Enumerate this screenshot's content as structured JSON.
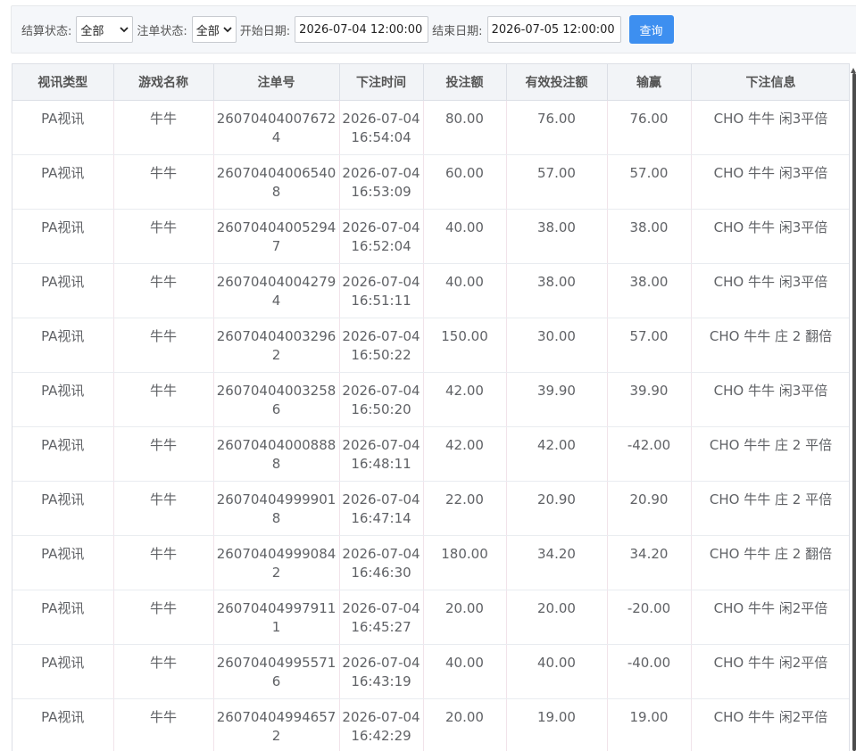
{
  "filters": {
    "settle_label": "结算状态:",
    "settle_value": "全部",
    "order_label": "注单状态:",
    "order_value": "全部",
    "start_label": "开始日期:",
    "start_value": "2026-07-04 12:00:00",
    "end_label": "结束日期:",
    "end_value": "2026-07-05 12:00:00",
    "query_label": "查询"
  },
  "table": {
    "headers": [
      "视讯类型",
      "游戏名称",
      "注单号",
      "下注时间",
      "投注额",
      "有效投注额",
      "输赢",
      "下注信息"
    ],
    "rows": [
      [
        "PA视讯",
        "牛牛",
        "260704040076724",
        "2026-07-04 16:54:04",
        "80.00",
        "76.00",
        "76.00",
        "CHO 牛牛 闲3平倍"
      ],
      [
        "PA视讯",
        "牛牛",
        "260704040065408",
        "2026-07-04 16:53:09",
        "60.00",
        "57.00",
        "57.00",
        "CHO 牛牛 闲3平倍"
      ],
      [
        "PA视讯",
        "牛牛",
        "260704040052947",
        "2026-07-04 16:52:04",
        "40.00",
        "38.00",
        "38.00",
        "CHO 牛牛 闲3平倍"
      ],
      [
        "PA视讯",
        "牛牛",
        "260704040042794",
        "2026-07-04 16:51:11",
        "40.00",
        "38.00",
        "38.00",
        "CHO 牛牛 闲3平倍"
      ],
      [
        "PA视讯",
        "牛牛",
        "260704040032962",
        "2026-07-04 16:50:22",
        "150.00",
        "30.00",
        "57.00",
        "CHO 牛牛 庄 2 翻倍"
      ],
      [
        "PA视讯",
        "牛牛",
        "260704040032586",
        "2026-07-04 16:50:20",
        "42.00",
        "39.90",
        "39.90",
        "CHO 牛牛 闲3平倍"
      ],
      [
        "PA视讯",
        "牛牛",
        "260704040008888",
        "2026-07-04 16:48:11",
        "42.00",
        "42.00",
        "-42.00",
        "CHO 牛牛 庄 2 平倍"
      ],
      [
        "PA视讯",
        "牛牛",
        "260704049999018",
        "2026-07-04 16:47:14",
        "22.00",
        "20.90",
        "20.90",
        "CHO 牛牛 庄 2 平倍"
      ],
      [
        "PA视讯",
        "牛牛",
        "260704049990842",
        "2026-07-04 16:46:30",
        "180.00",
        "34.20",
        "34.20",
        "CHO 牛牛 庄 2 翻倍"
      ],
      [
        "PA视讯",
        "牛牛",
        "260704049979111",
        "2026-07-04 16:45:27",
        "20.00",
        "20.00",
        "-20.00",
        "CHO 牛牛 闲2平倍"
      ],
      [
        "PA视讯",
        "牛牛",
        "260704049955716",
        "2026-07-04 16:43:19",
        "40.00",
        "40.00",
        "-40.00",
        "CHO 牛牛 闲2平倍"
      ],
      [
        "PA视讯",
        "牛牛",
        "260704049946572",
        "2026-07-04 16:42:29",
        "20.00",
        "19.00",
        "19.00",
        "CHO 牛牛 闲2平倍"
      ]
    ]
  },
  "colors": {
    "accent": "#3d8ff0",
    "header_bg": "#f2f4f7",
    "filter_bg": "#f5f7fa"
  },
  "icons": {
    "select_arrow": "chevron-down-icon"
  }
}
